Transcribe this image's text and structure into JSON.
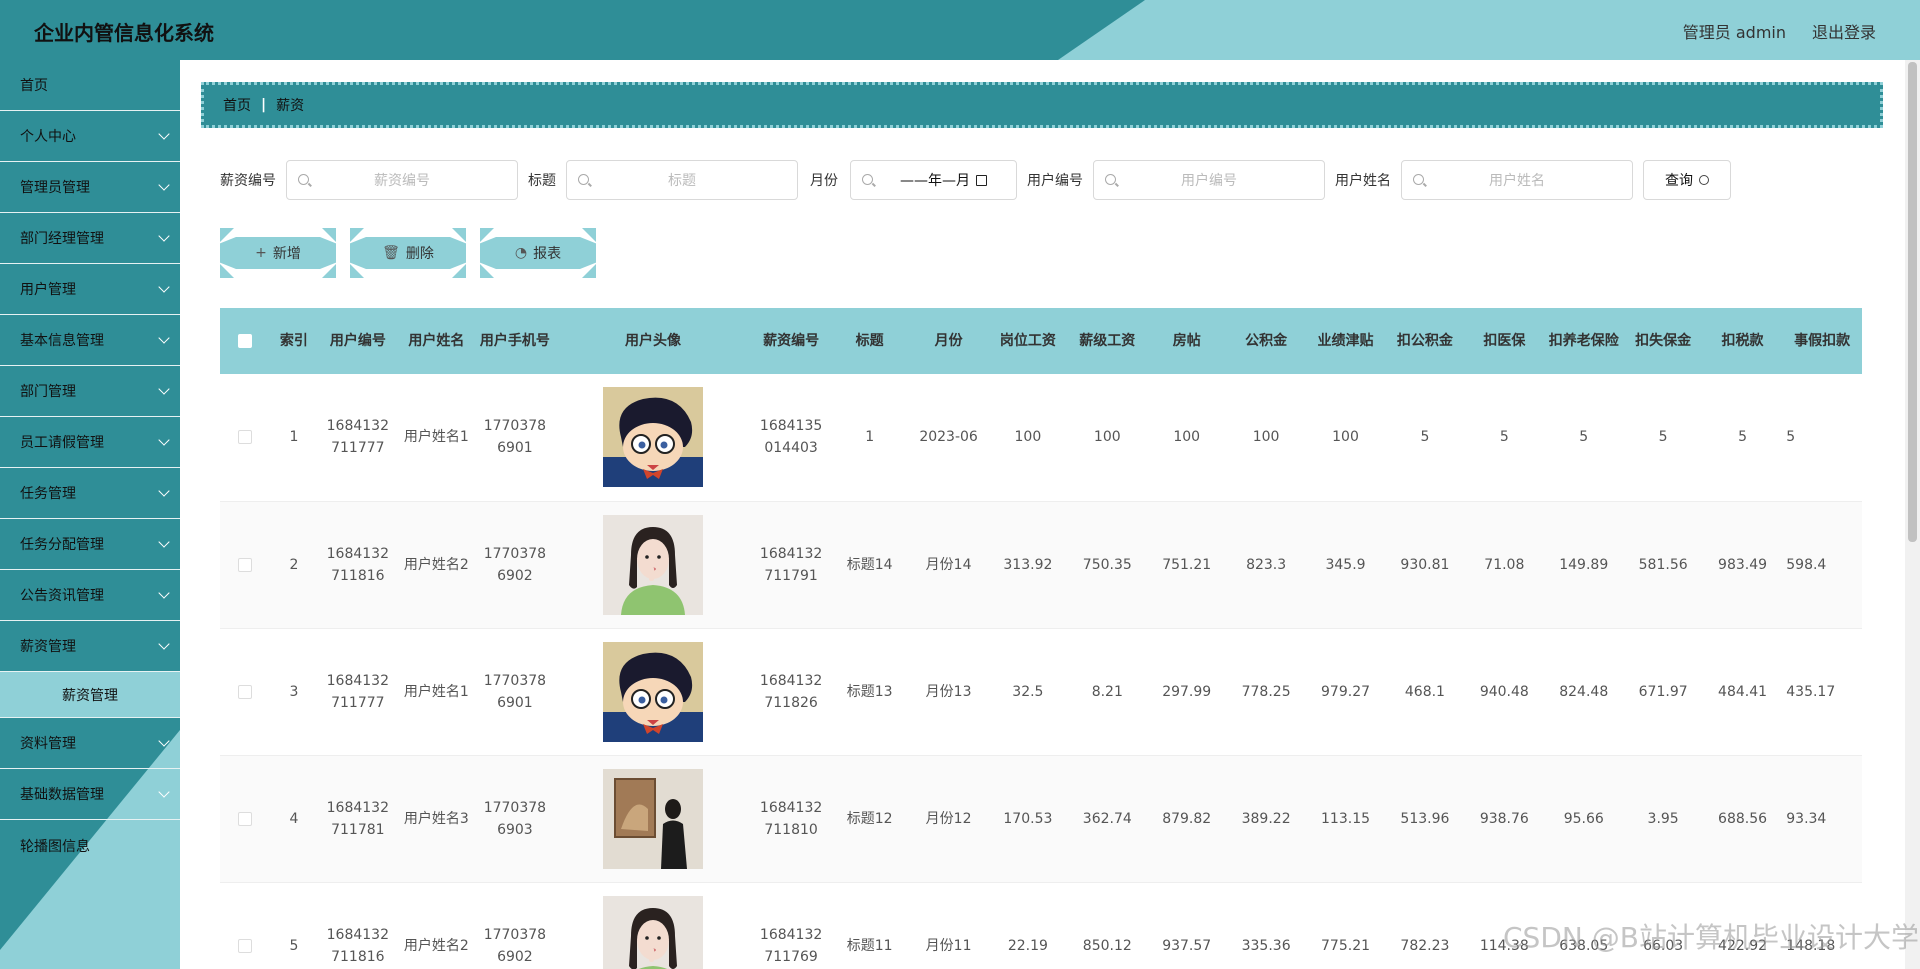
{
  "header": {
    "title": "企业内管信息化系统",
    "admin_label": "管理员 admin",
    "logout_label": "退出登录"
  },
  "sidebar": {
    "items": [
      {
        "label": "首页"
      },
      {
        "label": "个人中心"
      },
      {
        "label": "管理员管理"
      },
      {
        "label": "部门经理管理"
      },
      {
        "label": "用户管理"
      },
      {
        "label": "基本信息管理"
      },
      {
        "label": "部门管理"
      },
      {
        "label": "员工请假管理"
      },
      {
        "label": "任务管理"
      },
      {
        "label": "任务分配管理"
      },
      {
        "label": "公告资讯管理"
      },
      {
        "label": "薪资管理"
      },
      {
        "label": "资料管理"
      },
      {
        "label": "基础数据管理"
      },
      {
        "label": "轮播图信息"
      }
    ],
    "sub_item": "薪资管理"
  },
  "breadcrumb": {
    "home": "首页",
    "sep": "|",
    "current": "薪资"
  },
  "search": {
    "salary_no_label": "薪资编号",
    "salary_no_placeholder": "薪资编号",
    "title_label": "标题",
    "title_placeholder": "标题",
    "month_label": "月份",
    "month_value": "——年—月",
    "user_no_label": "用户编号",
    "user_no_placeholder": "用户编号",
    "user_name_label": "用户姓名",
    "user_name_placeholder": "用户姓名",
    "query_button": "查询"
  },
  "actions": {
    "add": "新增",
    "delete": "删除",
    "report": "报表"
  },
  "table": {
    "headers": [
      "索引",
      "用户编号",
      "用户姓名",
      "用户手机号",
      "用户头像",
      "薪资编号",
      "标题",
      "月份",
      "岗位工资",
      "薪级工资",
      "房帖",
      "公积金",
      "业绩津贴",
      "扣公积金",
      "扣医保",
      "扣养老保险",
      "扣失保金",
      "扣税款",
      "事假扣款"
    ],
    "rows": [
      {
        "idx": "1",
        "user_no": "1684132711777",
        "user_name": "用户姓名1",
        "phone": "17703786901",
        "avatar": "conan-avatar",
        "salary_no": "1684135014403",
        "title": "1",
        "month": "2023-06",
        "c1": "100",
        "c2": "100",
        "c3": "100",
        "c4": "100",
        "c5": "100",
        "c6": "5",
        "c7": "5",
        "c8": "5",
        "c9": "5",
        "c10": "5",
        "c11": "5"
      },
      {
        "idx": "2",
        "user_no": "1684132711816",
        "user_name": "用户姓名2",
        "phone": "17703786902",
        "avatar": "girl-avatar",
        "salary_no": "1684132711791",
        "title": "标题14",
        "month": "月份14",
        "c1": "313.92",
        "c2": "750.35",
        "c3": "751.21",
        "c4": "823.3",
        "c5": "345.9",
        "c6": "930.81",
        "c7": "71.08",
        "c8": "149.89",
        "c9": "581.56",
        "c10": "983.49",
        "c11": "598.4"
      },
      {
        "idx": "3",
        "user_no": "1684132711777",
        "user_name": "用户姓名1",
        "phone": "17703786901",
        "avatar": "conan-avatar",
        "salary_no": "1684132711826",
        "title": "标题13",
        "month": "月份13",
        "c1": "32.5",
        "c2": "8.21",
        "c3": "297.99",
        "c4": "778.25",
        "c5": "979.27",
        "c6": "468.1",
        "c7": "940.48",
        "c8": "824.48",
        "c9": "671.97",
        "c10": "484.41",
        "c11": "435.17"
      },
      {
        "idx": "4",
        "user_no": "1684132711781",
        "user_name": "用户姓名3",
        "phone": "17703786903",
        "avatar": "gallery-avatar",
        "salary_no": "1684132711810",
        "title": "标题12",
        "month": "月份12",
        "c1": "170.53",
        "c2": "362.74",
        "c3": "879.82",
        "c4": "389.22",
        "c5": "113.15",
        "c6": "513.96",
        "c7": "938.76",
        "c8": "95.66",
        "c9": "3.95",
        "c10": "688.56",
        "c11": "93.34"
      },
      {
        "idx": "5",
        "user_no": "1684132711816",
        "user_name": "用户姓名2",
        "phone": "17703786902",
        "avatar": "girl-avatar",
        "salary_no": "1684132711769",
        "title": "标题11",
        "month": "月份11",
        "c1": "22.19",
        "c2": "850.12",
        "c3": "937.57",
        "c4": "335.36",
        "c5": "775.21",
        "c6": "782.23",
        "c7": "114.38",
        "c8": "638.05",
        "c9": "66.03",
        "c10": "422.92",
        "c11": "148.18"
      }
    ]
  },
  "watermark": "CSDN @B站计算机毕业设计大学",
  "colors": {
    "primary_dark": "#2f8e97",
    "primary_light": "#8fd0d7"
  }
}
